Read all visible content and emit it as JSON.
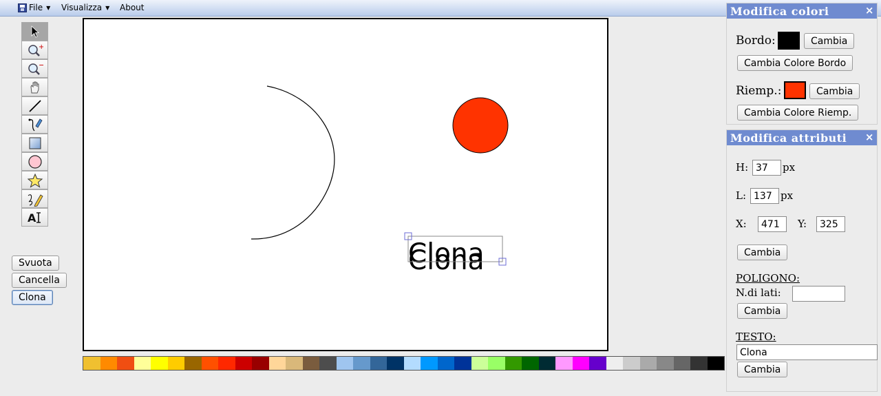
{
  "menu": {
    "file": "File",
    "view": "Visualizza",
    "about": "About"
  },
  "tools": [
    {
      "name": "select-tool",
      "icon": "pointer-icon",
      "glyph": "↖"
    },
    {
      "name": "zoom-in-tool",
      "icon": "zoom-in-icon",
      "glyph": "🔍"
    },
    {
      "name": "zoom-out-tool",
      "icon": "zoom-out-icon",
      "glyph": "🔍"
    },
    {
      "name": "pan-tool",
      "icon": "hand-icon",
      "glyph": "✋"
    },
    {
      "name": "line-tool",
      "icon": "line-icon",
      "glyph": "╱"
    },
    {
      "name": "bezier-tool",
      "icon": "pen-icon",
      "glyph": "✒"
    },
    {
      "name": "rectangle-tool",
      "icon": "rectangle-icon",
      "glyph": "▢"
    },
    {
      "name": "circle-tool",
      "icon": "circle-icon",
      "glyph": "○"
    },
    {
      "name": "polygon-tool",
      "icon": "star-icon",
      "glyph": "☆"
    },
    {
      "name": "freehand-tool",
      "icon": "pencil-icon",
      "glyph": "✎"
    },
    {
      "name": "text-tool",
      "icon": "text-icon",
      "glyph": "AI"
    }
  ],
  "side_buttons": {
    "clear": "Svuota",
    "delete": "Cancella",
    "clone": "Clona"
  },
  "canvas": {
    "text_object": "Clona",
    "circle_fill": "#ff3300",
    "selection_color": "#6b6bd6"
  },
  "palette": [
    "#f0c030",
    "#ff8a00",
    "#f04e12",
    "#ffff99",
    "#ffff00",
    "#ffcc00",
    "#996600",
    "#ff5000",
    "#ff2800",
    "#cc0000",
    "#990000",
    "#ffd699",
    "#d9b87a",
    "#7a5c3e",
    "#4d4d4d",
    "#9fc5ef",
    "#6699cc",
    "#336699",
    "#003366",
    "#b3dcff",
    "#0099ff",
    "#0066cc",
    "#003399",
    "#ccff99",
    "#99ff66",
    "#339900",
    "#006600",
    "#002b33",
    "#ff99ff",
    "#ff00ff",
    "#6600cc",
    "#eeeeee",
    "#cccccc",
    "#aaaaaa",
    "#888888",
    "#666666",
    "#333333",
    "#000000"
  ],
  "colors_panel": {
    "title": "Modifica colori",
    "close": "×",
    "border_label": "Bordo:",
    "border_color": "#000000",
    "border_change": "Cambia",
    "border_change_full": "Cambia Colore Bordo",
    "fill_label": "Riemp.:",
    "fill_color": "#ff3300",
    "fill_change": "Cambia",
    "fill_change_full": "Cambia Colore Riemp."
  },
  "attributes_panel": {
    "title": "Modifica attributi",
    "close": "×",
    "h_label": "H:",
    "h_value": "37",
    "h_unit": "px",
    "l_label": "L:",
    "l_value": "137",
    "l_unit": "px",
    "x_label": "X:",
    "x_value": "471",
    "y_label": "Y:",
    "y_value": "325",
    "change": "Cambia",
    "polygon_heading": "POLIGONO:",
    "sides_label": "N.di lati:",
    "sides_value": "",
    "polygon_change": "Cambia",
    "text_heading": "TESTO:",
    "text_value": "Clona",
    "text_change": "Cambia"
  }
}
